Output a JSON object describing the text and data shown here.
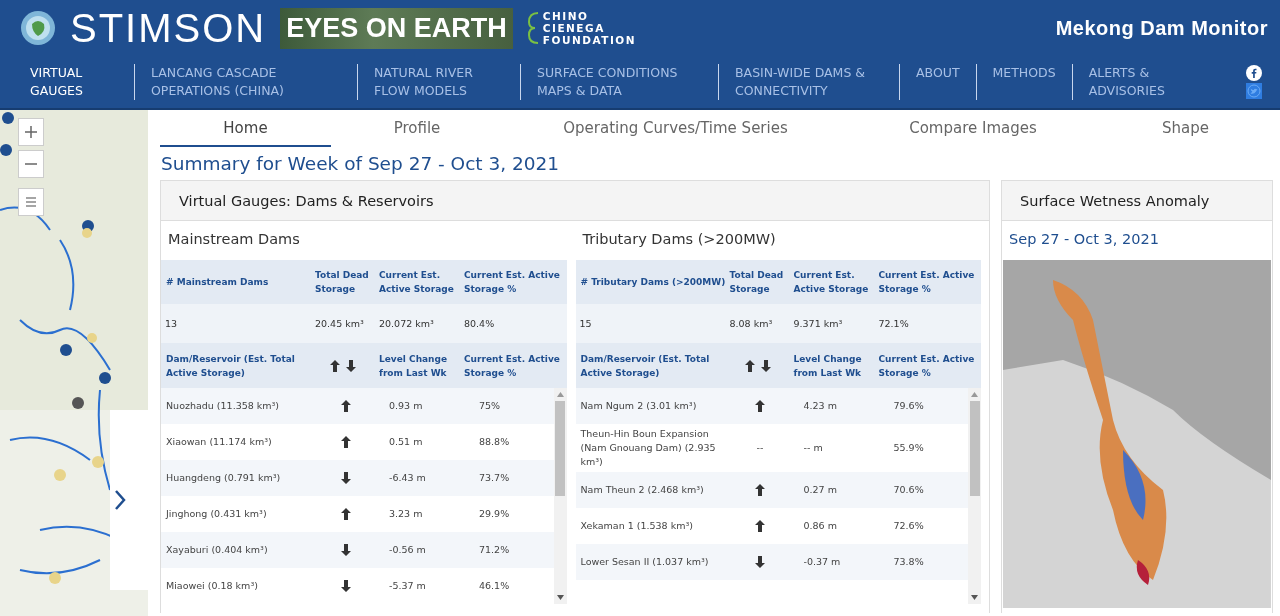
{
  "header": {
    "logos": [
      {
        "kind": "stimson",
        "text": "STIMSON"
      },
      {
        "kind": "eyes",
        "text": "EYES ON EARTH"
      },
      {
        "kind": "chino",
        "text": "CHINO\nCIENEGA\nFOUNDATION"
      }
    ],
    "title": "Mekong Dam Monitor"
  },
  "nav": {
    "items": [
      {
        "label": "VIRTUAL\nGAUGES",
        "selected": true
      },
      {
        "label": "LANCANG CASCADE\nOPERATIONS (CHINA)",
        "selected": false
      },
      {
        "label": "NATURAL RIVER\nFLOW MODELS",
        "selected": false
      },
      {
        "label": "SURFACE CONDITIONS\nMAPS & DATA",
        "selected": false
      },
      {
        "label": "BASIN-WIDE DAMS &\nCONNECTIVITY",
        "selected": false
      },
      {
        "label": "ABOUT",
        "selected": false
      },
      {
        "label": "METHODS",
        "selected": false
      },
      {
        "label": "ALERTS &\nADVISORIES",
        "selected": false
      }
    ]
  },
  "tabs": [
    {
      "label": "Home",
      "selected": true
    },
    {
      "label": "Profile",
      "selected": false
    },
    {
      "label": "Operating Curves/Time Series",
      "selected": false
    },
    {
      "label": "Compare Images",
      "selected": false
    },
    {
      "label": "Shape",
      "selected": false
    }
  ],
  "summary_title": "Summary for Week of Sep 27 - Oct 3, 2021",
  "gauges_panel": {
    "title": "Virtual Gauges: Dams & Reservoirs",
    "sections": [
      {
        "title": "Mainstream Dams",
        "summary_columns": [
          "# Mainstream Dams",
          "Total Dead Storage",
          "Current Est. Active Storage",
          "Current Est. Active Storage %"
        ],
        "summary_row": [
          "13",
          "20.45 km³",
          "20.072 km³",
          "80.4%"
        ],
        "detail_columns": [
          "Dam/Reservoir (Est. Total Active Storage)",
          "Level Change from Last Wk",
          "Current Est. Active Storage %"
        ],
        "rows": [
          {
            "name": "Nuozhadu (11.358 km³)",
            "kind": "up",
            "change": "0.93 m",
            "percent": "75%"
          },
          {
            "name": "Xiaowan (11.174 km³)",
            "kind": "up",
            "change": "0.51 m",
            "percent": "88.8%"
          },
          {
            "name": "Huangdeng (0.791 km³)",
            "kind": "down",
            "change": "-6.43 m",
            "percent": "73.7%"
          },
          {
            "name": "Jinghong (0.431 km³)",
            "kind": "up",
            "change": "3.23 m",
            "percent": "29.9%"
          },
          {
            "name": "Xayaburi (0.404 km³)",
            "kind": "down",
            "change": "-0.56 m",
            "percent": "71.2%"
          },
          {
            "name": "Miaowei (0.18 km³)",
            "kind": "down",
            "change": "-5.37 m",
            "percent": "46.1%"
          }
        ]
      },
      {
        "title": "Tributary Dams (>200MW)",
        "summary_columns": [
          "# Tributary Dams (>200MW)",
          "Total Dead Storage",
          "Current Est. Active Storage",
          "Current Est. Active Storage %"
        ],
        "summary_row": [
          "15",
          "8.08 km³",
          "9.371 km³",
          "72.1%"
        ],
        "detail_columns": [
          "Dam/Reservoir (Est. Total Active Storage)",
          "Level Change from Last Wk",
          "Current Est. Active Storage %"
        ],
        "rows": [
          {
            "name": "Nam Ngum 2 (3.01 km³)",
            "kind": "up",
            "change": "4.23 m",
            "percent": "79.6%"
          },
          {
            "name": "Theun-Hin Boun Expansion (Nam Gnouang Dam) (2.935 km³)",
            "kind": "text",
            "trend_text": "--",
            "change": "-- m",
            "percent": "55.9%"
          },
          {
            "name": "Nam Theun 2 (2.468 km³)",
            "kind": "up",
            "change": "0.27 m",
            "percent": "70.6%"
          },
          {
            "name": "Xekaman 1 (1.538 km³)",
            "kind": "up",
            "change": "0.86 m",
            "percent": "72.6%"
          },
          {
            "name": "Lower Sesan II (1.037 km³)",
            "kind": "down",
            "change": "-0.37 m",
            "percent": "73.8%"
          }
        ]
      }
    ]
  },
  "wetness_panel": {
    "title": "Surface Wetness Anomaly",
    "date": "Sep 27 - Oct 3, 2021"
  }
}
